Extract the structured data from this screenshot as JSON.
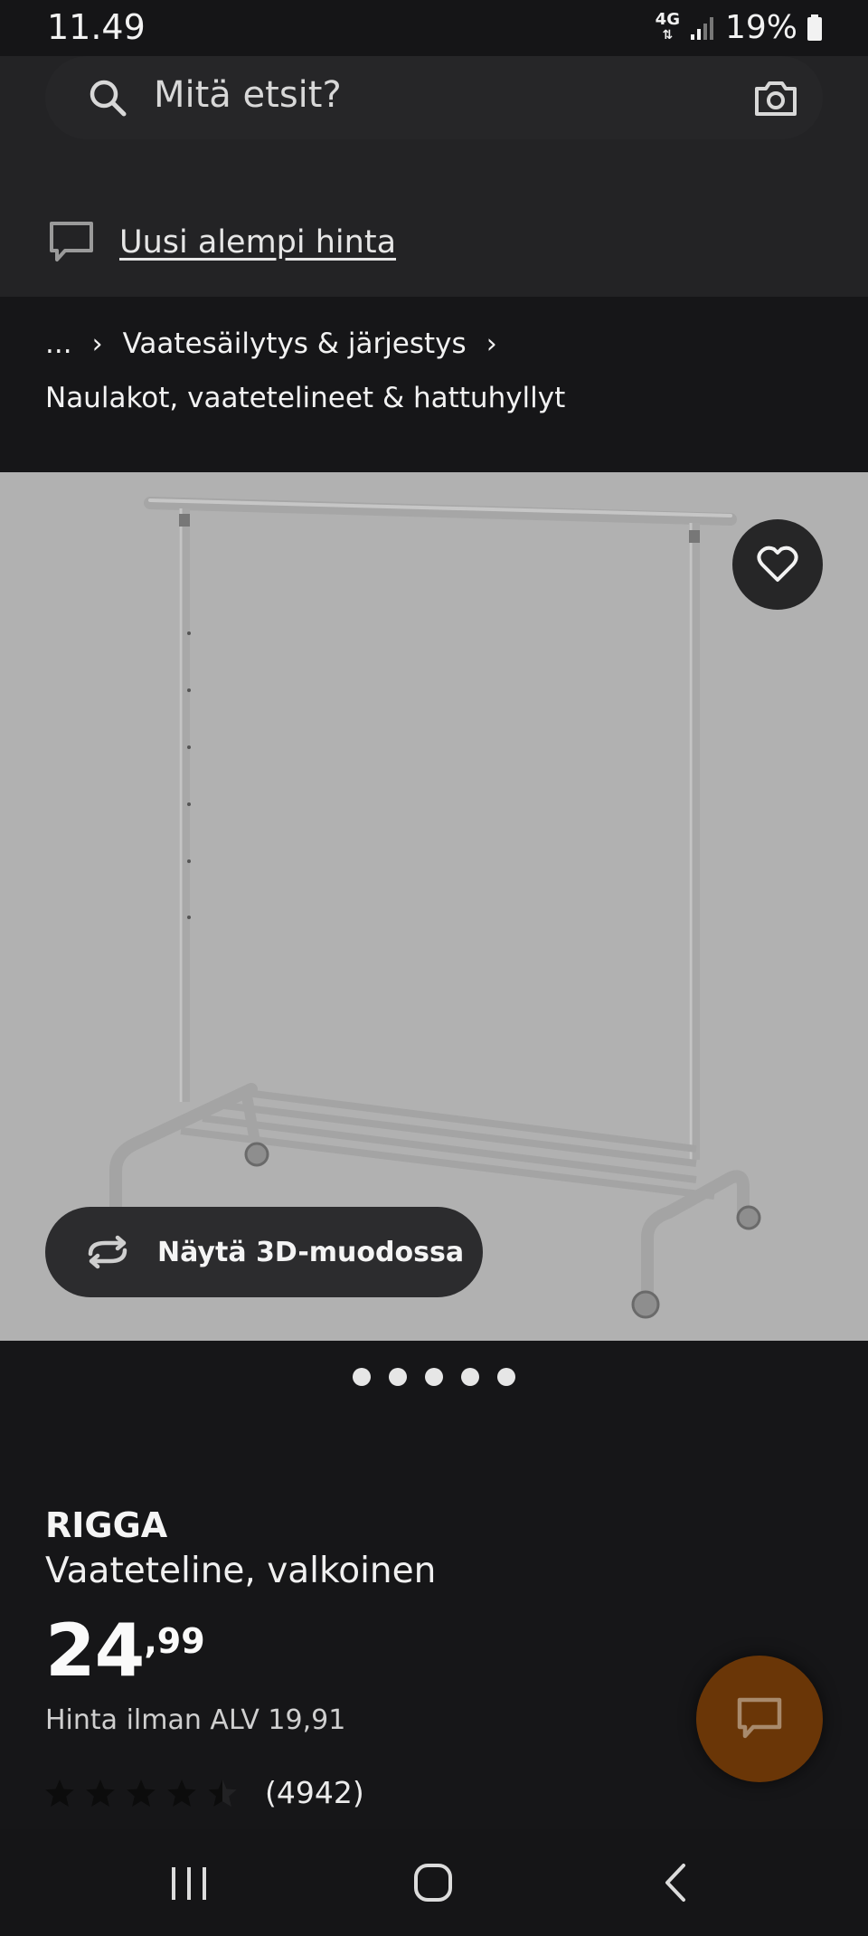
{
  "status_bar": {
    "time": "11.49",
    "network_label": "4G",
    "battery_percent": "19%"
  },
  "search": {
    "placeholder": "Mitä etsit?"
  },
  "notice": {
    "link_text": "Uusi alempi hinta"
  },
  "breadcrumb": {
    "ellipsis": "...",
    "category": "Vaatesäilytys & järjestys",
    "current": "Naulakot, vaatetelineet & hattuhyllyt"
  },
  "gallery": {
    "view_3d_label": "Näytä 3D-muodossa",
    "image_count": 5,
    "active_index": 0
  },
  "product": {
    "brand": "RIGGA",
    "description": "Vaateteline, valkoinen",
    "price_integer": "24",
    "price_decimal": ",99",
    "vat_text": "Hinta ilman ALV 19,91",
    "rating_value": 4.5,
    "rating_max": 5,
    "review_count": "(4942)"
  },
  "colors": {
    "background": "#161618",
    "header": "#232325",
    "image_bg": "#b1b1b1",
    "chat_fab": "#6a3607"
  },
  "icons": [
    "search-icon",
    "camera-icon",
    "chat-bubble-icon",
    "heart-icon",
    "rotate-3d-icon",
    "star-icon",
    "chat-icon",
    "nav-recent-icon",
    "nav-home-icon",
    "nav-back-icon"
  ]
}
